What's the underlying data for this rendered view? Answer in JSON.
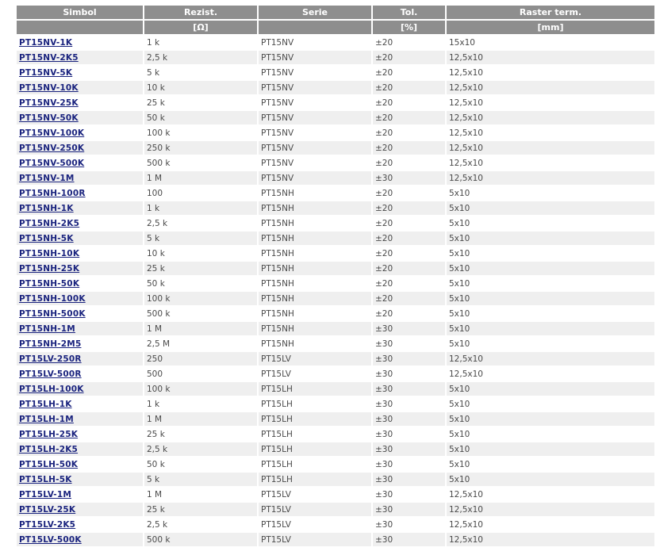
{
  "headers": [
    "Simbol",
    "Rezist.",
    "Serie",
    "Tol.",
    "Raster term."
  ],
  "units": [
    "",
    "[Ω]",
    "",
    "[%]",
    "[mm]"
  ],
  "rows": [
    {
      "simbol": "PT15NV-1K",
      "rezist": "1 k",
      "serie": "PT15NV",
      "tol": "±20",
      "raster": "15x10"
    },
    {
      "simbol": "PT15NV-2K5",
      "rezist": "2,5 k",
      "serie": "PT15NV",
      "tol": "±20",
      "raster": "12,5x10"
    },
    {
      "simbol": "PT15NV-5K",
      "rezist": "5 k",
      "serie": "PT15NV",
      "tol": "±20",
      "raster": "12,5x10"
    },
    {
      "simbol": "PT15NV-10K",
      "rezist": "10 k",
      "serie": "PT15NV",
      "tol": "±20",
      "raster": "12,5x10"
    },
    {
      "simbol": "PT15NV-25K",
      "rezist": "25 k",
      "serie": "PT15NV",
      "tol": "±20",
      "raster": "12,5x10"
    },
    {
      "simbol": "PT15NV-50K",
      "rezist": "50 k",
      "serie": "PT15NV",
      "tol": "±20",
      "raster": "12,5x10"
    },
    {
      "simbol": "PT15NV-100K",
      "rezist": "100 k",
      "serie": "PT15NV",
      "tol": "±20",
      "raster": "12,5x10"
    },
    {
      "simbol": "PT15NV-250K",
      "rezist": "250 k",
      "serie": "PT15NV",
      "tol": "±20",
      "raster": "12,5x10"
    },
    {
      "simbol": "PT15NV-500K",
      "rezist": "500 k",
      "serie": "PT15NV",
      "tol": "±20",
      "raster": "12,5x10"
    },
    {
      "simbol": "PT15NV-1M",
      "rezist": "1 M",
      "serie": "PT15NV",
      "tol": "±30",
      "raster": "12,5x10"
    },
    {
      "simbol": "PT15NH-100R",
      "rezist": "100",
      "serie": "PT15NH",
      "tol": "±20",
      "raster": "5x10"
    },
    {
      "simbol": "PT15NH-1K",
      "rezist": "1 k",
      "serie": "PT15NH",
      "tol": "±20",
      "raster": "5x10"
    },
    {
      "simbol": "PT15NH-2K5",
      "rezist": "2,5 k",
      "serie": "PT15NH",
      "tol": "±20",
      "raster": "5x10"
    },
    {
      "simbol": "PT15NH-5K",
      "rezist": "5 k",
      "serie": "PT15NH",
      "tol": "±20",
      "raster": "5x10"
    },
    {
      "simbol": "PT15NH-10K",
      "rezist": "10 k",
      "serie": "PT15NH",
      "tol": "±20",
      "raster": "5x10"
    },
    {
      "simbol": "PT15NH-25K",
      "rezist": "25 k",
      "serie": "PT15NH",
      "tol": "±20",
      "raster": "5x10"
    },
    {
      "simbol": "PT15NH-50K",
      "rezist": "50 k",
      "serie": "PT15NH",
      "tol": "±20",
      "raster": "5x10"
    },
    {
      "simbol": "PT15NH-100K",
      "rezist": "100 k",
      "serie": "PT15NH",
      "tol": "±20",
      "raster": "5x10"
    },
    {
      "simbol": "PT15NH-500K",
      "rezist": "500 k",
      "serie": "PT15NH",
      "tol": "±20",
      "raster": "5x10"
    },
    {
      "simbol": "PT15NH-1M",
      "rezist": "1 M",
      "serie": "PT15NH",
      "tol": "±30",
      "raster": "5x10"
    },
    {
      "simbol": "PT15NH-2M5",
      "rezist": "2,5 M",
      "serie": "PT15NH",
      "tol": "±30",
      "raster": "5x10"
    },
    {
      "simbol": "PT15LV-250R",
      "rezist": "250",
      "serie": "PT15LV",
      "tol": "±30",
      "raster": "12,5x10"
    },
    {
      "simbol": "PT15LV-500R",
      "rezist": "500",
      "serie": "PT15LV",
      "tol": "±30",
      "raster": "12,5x10"
    },
    {
      "simbol": "PT15LH-100K",
      "rezist": "100 k",
      "serie": "PT15LH",
      "tol": "±30",
      "raster": "5x10"
    },
    {
      "simbol": "PT15LH-1K",
      "rezist": "1 k",
      "serie": "PT15LH",
      "tol": "±30",
      "raster": "5x10"
    },
    {
      "simbol": "PT15LH-1M",
      "rezist": "1 M",
      "serie": "PT15LH",
      "tol": "±30",
      "raster": "5x10"
    },
    {
      "simbol": "PT15LH-25K",
      "rezist": "25 k",
      "serie": "PT15LH",
      "tol": "±30",
      "raster": "5x10"
    },
    {
      "simbol": "PT15LH-2K5",
      "rezist": "2,5 k",
      "serie": "PT15LH",
      "tol": "±30",
      "raster": "5x10"
    },
    {
      "simbol": "PT15LH-50K",
      "rezist": "50 k",
      "serie": "PT15LH",
      "tol": "±30",
      "raster": "5x10"
    },
    {
      "simbol": "PT15LH-5K",
      "rezist": "5 k",
      "serie": "PT15LH",
      "tol": "±30",
      "raster": "5x10"
    },
    {
      "simbol": "PT15LV-1M",
      "rezist": "1 M",
      "serie": "PT15LV",
      "tol": "±30",
      "raster": "12,5x10"
    },
    {
      "simbol": "PT15LV-25K",
      "rezist": "25 k",
      "serie": "PT15LV",
      "tol": "±30",
      "raster": "12,5x10"
    },
    {
      "simbol": "PT15LV-2K5",
      "rezist": "2,5 k",
      "serie": "PT15LV",
      "tol": "±30",
      "raster": "12,5x10"
    },
    {
      "simbol": "PT15LV-500K",
      "rezist": "500 k",
      "serie": "PT15LV",
      "tol": "±30",
      "raster": "12,5x10"
    }
  ],
  "colors": {
    "header_bg": "#8e8e8e",
    "header_text": "#ffffff",
    "row_alt_bg": "#efefef",
    "link": "#1a237e",
    "cell_text": "#4a4a4a"
  }
}
